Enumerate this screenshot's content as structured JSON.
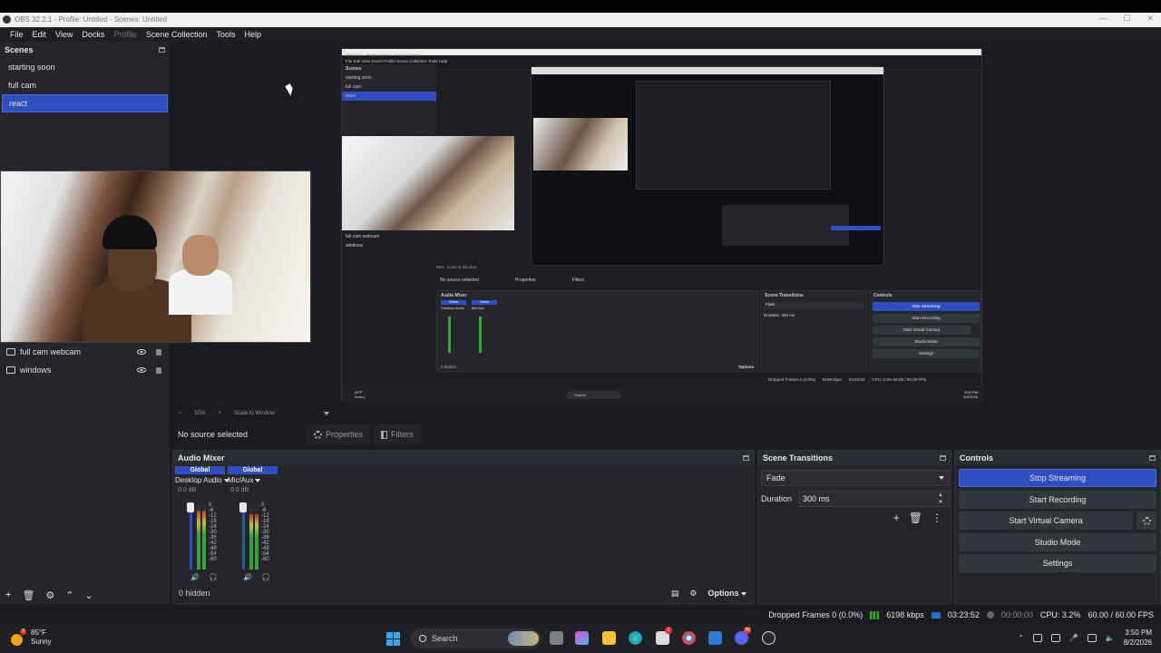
{
  "window": {
    "title": "OBS 32.2.1 - Profile: Untitled - Scenes: Untitled",
    "controls": [
      "—",
      "☐",
      "✕"
    ]
  },
  "menu": [
    "File",
    "Edit",
    "View",
    "Docks",
    "Profile",
    "Scene Collection",
    "Tools",
    "Help"
  ],
  "scenes": {
    "title": "Scenes",
    "items": [
      {
        "label": "starting soon",
        "active": false
      },
      {
        "label": "full cam",
        "active": false
      },
      {
        "label": "react",
        "active": true
      }
    ]
  },
  "sources": {
    "items": [
      {
        "label": "full cam webcam",
        "icon": "camera-icon"
      },
      {
        "label": "windows",
        "icon": "monitor-icon"
      }
    ],
    "toolbar": [
      "+",
      "🗑",
      "⚙",
      "⌃",
      "⌄"
    ]
  },
  "preview": {
    "zoom_minus": "−",
    "zoom": "55%",
    "zoom_plus": "+",
    "scale_mode": "Scale to Window"
  },
  "source_bar": {
    "no_source": "No source selected",
    "properties": "Properties",
    "filters": "Filters"
  },
  "audio_mixer": {
    "title": "Audio Mixer",
    "channels": [
      {
        "global": "Global",
        "name": "Desktop Audio",
        "db": "0.0 dB",
        "level": 0.9
      },
      {
        "global": "Global",
        "name": "Mic/Aux",
        "db": "0.0 dB",
        "level": 0.85
      }
    ],
    "scale": [
      "0",
      "-6",
      "-12",
      "-18",
      "-24",
      "-30",
      "-36",
      "-42",
      "-48",
      "-54",
      "-60"
    ],
    "hidden": "0 hidden",
    "options": "Options"
  },
  "scene_transitions": {
    "title": "Scene Transitions",
    "transition": "Fade",
    "duration_label": "Duration",
    "duration": "300 ms"
  },
  "controls": {
    "title": "Controls",
    "stop_streaming": "Stop Streaming",
    "start_recording": "Start Recording",
    "start_virtual_camera": "Start Virtual Camera",
    "studio_mode": "Studio Mode",
    "settings": "Settings"
  },
  "status": {
    "dropped_frames": "Dropped Frames 0 (0.0%)",
    "bitrate": "6198 kbps",
    "stream_time": "03:23:52",
    "rec_time": "00:00:00",
    "cpu": "CPU: 3.2%",
    "fps": "60.00 / 60.00 FPS"
  },
  "taskbar": {
    "temp": "85°F",
    "condition": "Sunny",
    "weather_badge": "3",
    "search": "Search",
    "time": "3:50 PM",
    "date": "8/2/2026",
    "badge_a": "1",
    "badge_b": "20"
  },
  "inner_capture": {
    "title": "OBS 32.2.1 - Profile: Untitled - Scenes: Untitled",
    "menu": "File   Edit   View   Docks   Profile   Scene Collection   Tools   Help",
    "scenes_title": "Scenes",
    "scenes": [
      "starting soon",
      "full cam",
      "react"
    ],
    "sources": [
      "full cam webcam",
      "windows"
    ],
    "zoom": "55%",
    "scale_mode": "Scale to Window",
    "no_source": "No source selected",
    "properties": "Properties",
    "filters": "Filters",
    "mixer_title": "Audio Mixer",
    "mixer_ch1": "Desktop Audio",
    "mixer_ch2": "Mic/Aux",
    "global": "Global",
    "hidden": "0 hidden",
    "options": "Options",
    "transitions_title": "Scene Transitions",
    "fade": "Fade",
    "duration_label": "Duration",
    "duration": "300 ms",
    "controls_title": "Controls",
    "stop_streaming": "Stop Streaming",
    "start_recording": "Start Recording",
    "start_virtual_camera": "Start Virtual Camera",
    "studio_mode": "Studio Mode",
    "settings": "Settings",
    "dropped": "Dropped Frames 0 (0.0%)",
    "bitrate": "6198 kbps",
    "time": "03:23:52",
    "fps": "CPU: 0.0% 60.00 / 60.00 FPS",
    "temp": "85°F",
    "condition": "Sunny",
    "search": "Search",
    "clock": "3:50 PM",
    "date": "8/2/2026"
  },
  "colors": {
    "accent": "#2f4ec0",
    "panel": "#24262c",
    "background": "#1b1c20"
  }
}
